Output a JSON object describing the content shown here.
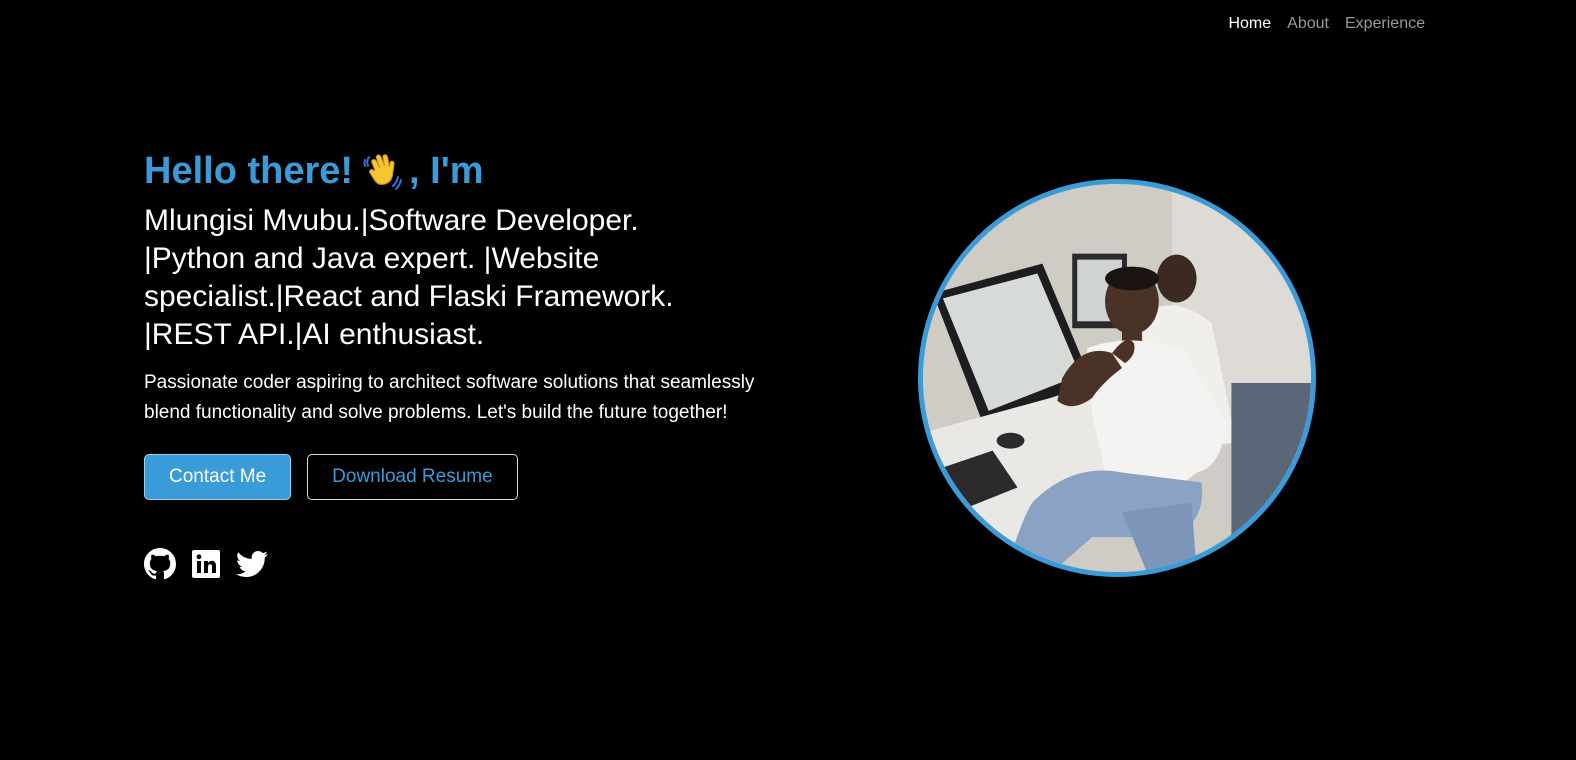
{
  "nav": {
    "items": [
      {
        "label": "Home",
        "active": true
      },
      {
        "label": "About",
        "active": false
      },
      {
        "label": "Experience",
        "active": false
      }
    ]
  },
  "hero": {
    "greeting_prefix": "Hello there!",
    "greeting_suffix": ", I'm",
    "wave_icon": "waving-hand-emoji",
    "typed_text": "Mlungisi Mvubu.|Software Developer. |Python and Java expert. |Website specialist.|React and Flaski Framework. |REST API.|AI enthusiast.",
    "intro": "Passionate coder aspiring to architect software solutions that seamlessly blend functionality and solve problems. Let's build the future together!",
    "contact_label": "Contact Me",
    "resume_label": "Download Resume"
  },
  "socials": [
    {
      "name": "github-icon"
    },
    {
      "name": "linkedin-icon"
    },
    {
      "name": "twitter-icon"
    }
  ],
  "profile": {
    "image": "profile-photo"
  },
  "colors": {
    "background": "#000000",
    "accent": "#3a9bd9",
    "text": "#ffffff",
    "nav_inactive": "#9a9a9a"
  }
}
